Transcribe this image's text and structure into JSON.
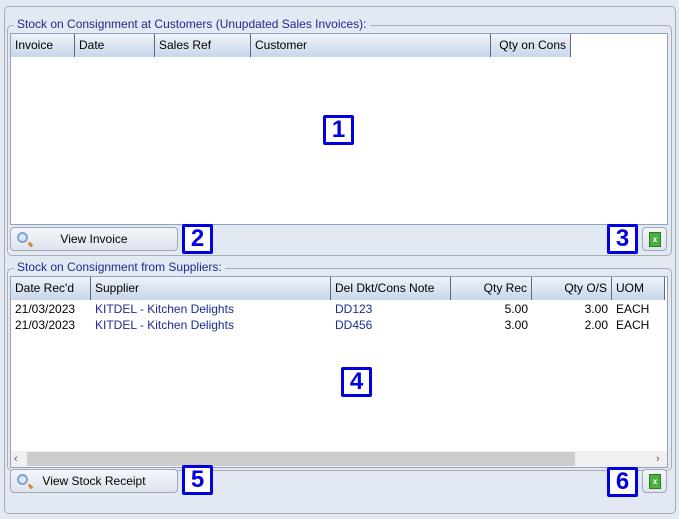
{
  "customers_section": {
    "title": "Stock on Consignment at Customers (Unupdated Sales Invoices):",
    "columns": [
      "Invoice",
      "Date",
      "Sales Ref",
      "Customer",
      "Qty on Cons"
    ],
    "rows": [],
    "view_button": "View Invoice",
    "callouts": [
      "1",
      "2",
      "3"
    ]
  },
  "suppliers_section": {
    "title": "Stock on Consignment from Suppliers:",
    "columns": [
      "Date Rec'd",
      "Supplier",
      "Del Dkt/Cons Note",
      "Qty Rec",
      "Qty O/S",
      "UOM"
    ],
    "rows": [
      [
        "21/03/2023",
        "KITDEL - Kitchen Delights",
        "DD123",
        "5.00",
        "3.00",
        "EACH"
      ],
      [
        "21/03/2023",
        "KITDEL - Kitchen Delights",
        "DD456",
        "3.00",
        "2.00",
        "EACH"
      ]
    ],
    "view_button": "View Stock Receipt",
    "callouts": [
      "4",
      "5",
      "6"
    ]
  },
  "colors": {
    "link": "#1c2c8c",
    "callout": "#0000e0",
    "excel": "#4caf3e"
  }
}
